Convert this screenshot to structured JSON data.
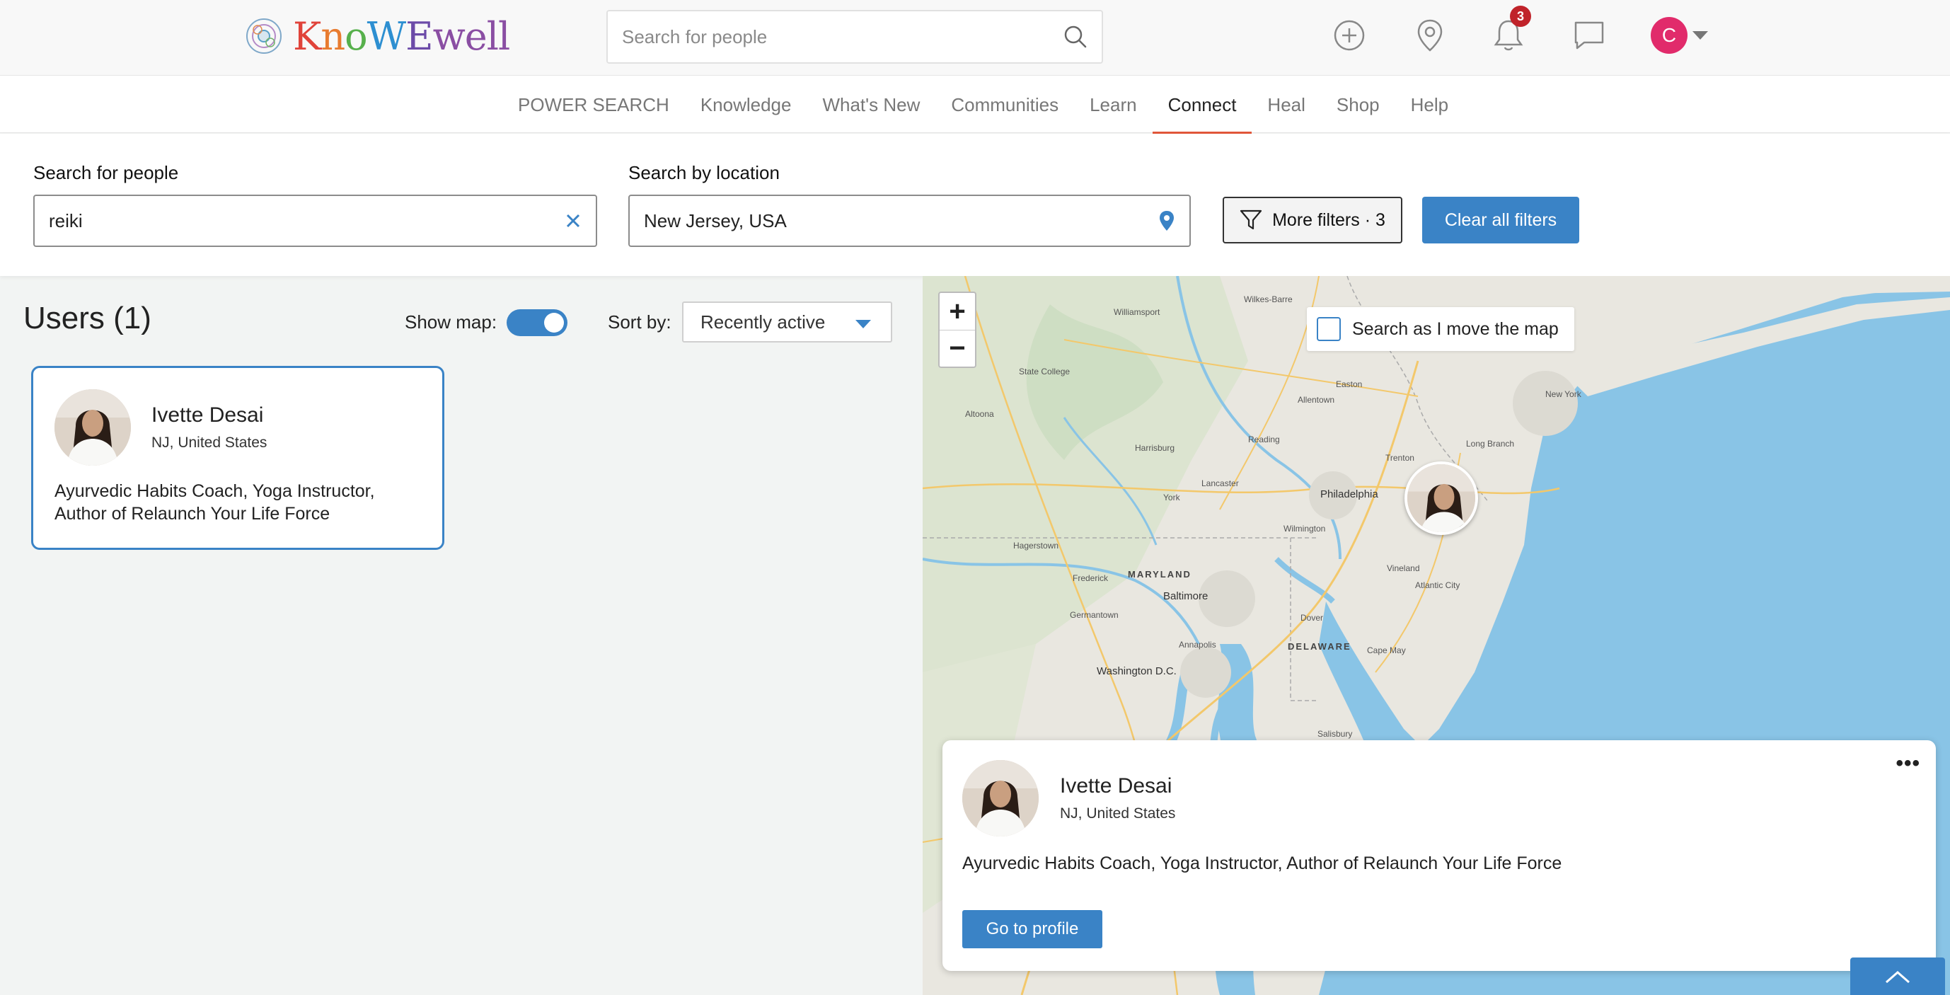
{
  "header": {
    "logo_text": "KnoWEwell",
    "search_placeholder": "Search for people",
    "notifications_count": "3",
    "user_initial": "C"
  },
  "nav": {
    "items": [
      "POWER SEARCH",
      "Knowledge",
      "What's New",
      "Communities",
      "Learn",
      "Connect",
      "Heal",
      "Shop",
      "Help"
    ],
    "active": "Connect"
  },
  "filters": {
    "people_label": "Search for people",
    "people_value": "reiki",
    "location_label": "Search by location",
    "location_value": "New Jersey, USA",
    "more_filters_label": "More filters · 3",
    "clear_label": "Clear all filters"
  },
  "results": {
    "title": "Users (1)",
    "show_map_label": "Show map:",
    "show_map_on": true,
    "sort_label": "Sort by:",
    "sort_value": "Recently active",
    "users": [
      {
        "name": "Ivette Desai",
        "location": "NJ, United States",
        "bio": "Ayurvedic Habits Coach, Yoga Instructor, Author of Relaunch Your Life Force"
      }
    ]
  },
  "map": {
    "zoom_in": "+",
    "zoom_out": "−",
    "search_move_label": "Search as I move the map",
    "labels": {
      "new_york": "New York",
      "philadelphia": "Philadelphia",
      "maryland": "MARYLAND",
      "delaware": "DELAWARE",
      "baltimore": "Baltimore",
      "washington": "Washington D.C.",
      "harrisburg": "Harrisburg",
      "allentown": "Allentown",
      "trenton": "Trenton",
      "york": "York",
      "lancaster": "Lancaster",
      "wilmington": "Wilmington",
      "dover": "Dover",
      "annapolis": "Annapolis",
      "frederick": "Frederick",
      "hagerstown": "Hagerstown",
      "reading": "Reading",
      "scranton": "Wilkes-Barre",
      "atlantic_city": "Atlantic City",
      "long_branch": "Long Branch",
      "vineland": "Vineland",
      "salisbury": "Salisbury",
      "state_college": "State College",
      "williamsport": "Williamsport",
      "easton": "Easton",
      "cape_may": "Cape May",
      "germantown": "Germantown",
      "altoona": "Altoona"
    },
    "popup": {
      "name": "Ivette Desai",
      "location": "NJ, United States",
      "bio": "Ayurvedic Habits Coach, Yoga Instructor, Author of Relaunch Your Life Force",
      "more": "•••",
      "button": "Go to profile"
    }
  },
  "colors": {
    "accent": "#3a83c6",
    "nav_active_underline": "#e2573a",
    "badge": "#c0232a",
    "avatar": "#e12b6b",
    "water": "#89c4e6"
  }
}
